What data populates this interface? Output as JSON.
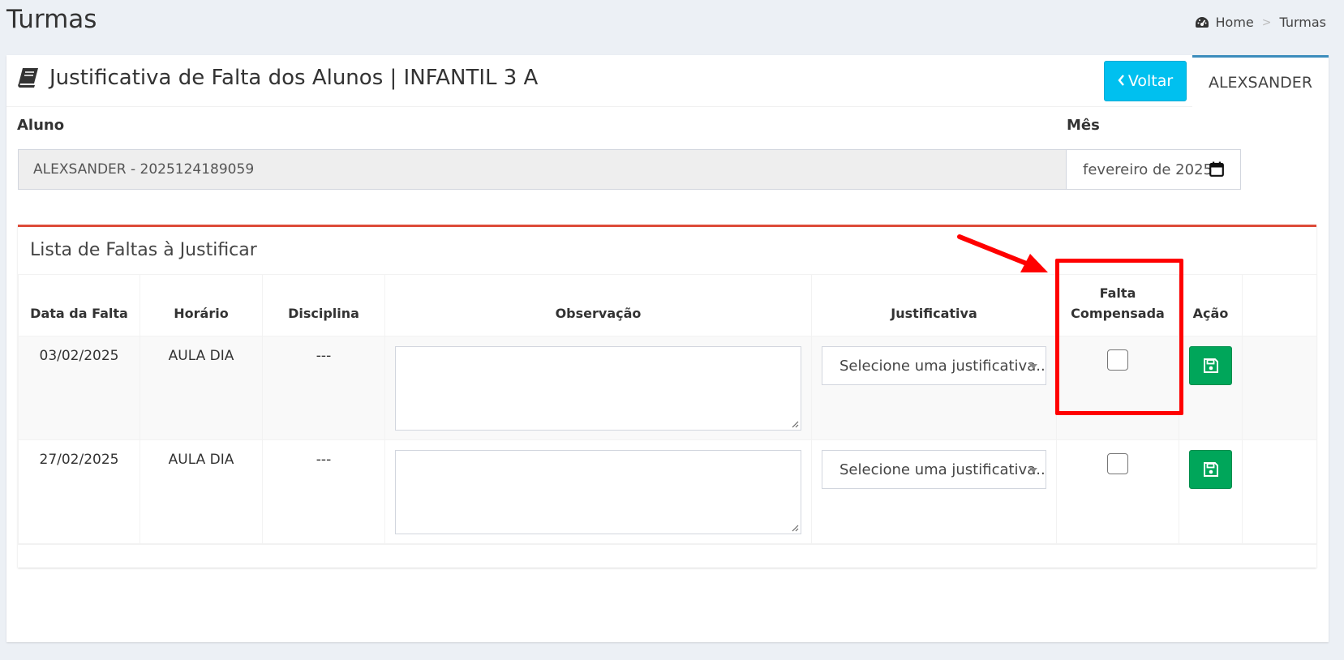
{
  "header": {
    "title": "Turmas",
    "breadcrumb": {
      "home": "Home",
      "separator": ">",
      "current": "Turmas"
    }
  },
  "card": {
    "title": "Justificativa de Falta dos Alunos | INFANTIL 3 A",
    "back_button": "Voltar",
    "user_tab": "ALEXSANDER"
  },
  "form": {
    "aluno_label": "Aluno",
    "aluno_value": "ALEXSANDER - 2025124189059",
    "mes_label": "Mês",
    "mes_value": "fevereiro de 2025"
  },
  "list": {
    "title": "Lista de Faltas à Justificar",
    "columns": {
      "data": "Data da Falta",
      "horario": "Horário",
      "disciplina": "Disciplina",
      "observacao": "Observação",
      "justificativa": "Justificativa",
      "falta_compensada_1": "Falta",
      "falta_compensada_2": "Compensada",
      "acao": "Ação"
    },
    "rows": [
      {
        "data": "03/02/2025",
        "horario": "AULA DIA",
        "disciplina": "---",
        "observacao": "",
        "justificativa": "Selecione uma justificativa...",
        "compensada": false
      },
      {
        "data": "27/02/2025",
        "horario": "AULA DIA",
        "disciplina": "---",
        "observacao": "",
        "justificativa": "Selecione uma justificativa...",
        "compensada": false
      }
    ]
  },
  "colors": {
    "background": "#ecf0f5",
    "info_button": "#00c0ef",
    "success_button": "#00a65a",
    "box_border": "#dd4b39",
    "tab_accent": "#3c8dbc",
    "annotation": "#ff0000"
  },
  "icons": {
    "breadcrumb": "dashboard-icon",
    "title": "book-icon",
    "back": "chevron-left-icon",
    "calendar": "calendar-icon",
    "save": "floppy-disk-icon"
  }
}
